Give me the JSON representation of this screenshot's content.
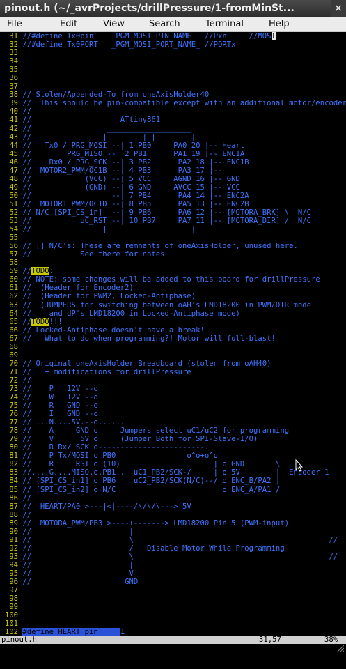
{
  "window": {
    "title": "pinout.h (~/_avrProjects/drillPressure/1-fromMinSt...",
    "close": "×"
  },
  "menu": [
    "File",
    "Edit",
    "View",
    "Search",
    "Terminal",
    "Help"
  ],
  "lines": [
    {
      "n": "31",
      "s": [
        {
          "t": "//#define Tx0pin    _PGM_MOSI_PIN_NAME_  //Pxn     //MOS"
        },
        {
          "t": "I",
          "c": "cursor"
        }
      ]
    },
    {
      "n": "32",
      "s": [
        {
          "t": "//#define Tx0PORT   _PGM_MOSI_PORT_NAME_ //PORTx"
        }
      ]
    },
    {
      "n": "33",
      "s": []
    },
    {
      "n": "34",
      "s": []
    },
    {
      "n": "35",
      "s": []
    },
    {
      "n": "36",
      "s": []
    },
    {
      "n": "37",
      "s": []
    },
    {
      "n": "38",
      "s": [
        {
          "t": "// Stolen/Appended-To from oneAxisHolder40"
        }
      ]
    },
    {
      "n": "39",
      "s": [
        {
          "t": "//  This should be pin-compatible except with an additional motor/encoder."
        }
      ]
    },
    {
      "n": "40",
      "s": [
        {
          "t": "//"
        }
      ]
    },
    {
      "n": "41",
      "s": [
        {
          "t": "//                    ATtiny861"
        }
      ]
    },
    {
      "n": "42",
      "s": [
        {
          "t": "//                 ___________________"
        }
      ]
    },
    {
      "n": "43",
      "s": [
        {
          "t": "//                |        |_|        |"
        }
      ]
    },
    {
      "n": "44",
      "s": [
        {
          "t": "//   Tx0 / PRG_MOSI --| 1 PB0     PA0 20 |-- Heart"
        }
      ]
    },
    {
      "n": "45",
      "s": [
        {
          "t": "//        PRG_MISO --| 2 PB1      PA1 19 |-- ENC1A"
        }
      ]
    },
    {
      "n": "46",
      "s": [
        {
          "t": "//    Rx0 / PRG_SCK --| 3 PB2      PA2 18 |-- ENC1B"
        }
      ]
    },
    {
      "n": "47",
      "s": [
        {
          "t": "//  MOTOR2_PWM/OC1B --| 4 PB3      PA3 17 |--"
        }
      ]
    },
    {
      "n": "48",
      "s": [
        {
          "t": "//            (VCC) --| 5 VCC     AGND 16 |-- GND"
        }
      ]
    },
    {
      "n": "49",
      "s": [
        {
          "t": "//            (GND) --| 6 GND     AVCC 15 |-- VCC"
        }
      ]
    },
    {
      "n": "50",
      "s": [
        {
          "t": "//                  --| 7 PB4      PA4 14 |-- ENC2A"
        }
      ]
    },
    {
      "n": "51",
      "s": [
        {
          "t": "//  MOTOR1_PWM/OC1D --| 8 PB5      PA5 13 |-- ENC2B"
        }
      ]
    },
    {
      "n": "52",
      "s": [
        {
          "t": "// N/C [SPI_CS_in]  --| 9 PB6      PA6 12 |-- [MOTORA_BRK] \\  N/C"
        }
      ]
    },
    {
      "n": "53",
      "s": [
        {
          "t": "//           uC_RST --| 10 PB7     PA7 11 |-- [MOTORA_DIR] /  N/C"
        }
      ]
    },
    {
      "n": "54",
      "s": [
        {
          "t": "//                |___________________|"
        }
      ]
    },
    {
      "n": "55",
      "s": []
    },
    {
      "n": "56",
      "s": [
        {
          "t": "// [] N/C's: These are remnants of oneAxisHolder, unused here."
        }
      ]
    },
    {
      "n": "57",
      "s": [
        {
          "t": "//           See there for notes"
        }
      ]
    },
    {
      "n": "58",
      "s": []
    },
    {
      "n": "59",
      "s": [
        {
          "t": "//"
        },
        {
          "t": "TODO",
          "c": "todo"
        },
        {
          "t": ":"
        }
      ]
    },
    {
      "n": "60",
      "s": [
        {
          "t": "// NOTE: some changes will be added to this board for drillPressure"
        }
      ]
    },
    {
      "n": "61",
      "s": [
        {
          "t": "//  (Header for Encoder2)"
        }
      ]
    },
    {
      "n": "62",
      "s": [
        {
          "t": "//  (Header for PWM2, Locked-Antiphase)"
        }
      ]
    },
    {
      "n": "63",
      "s": [
        {
          "t": "//  (JUMPERS for switching between oAH's LMD18200 in PWM/DIR mode"
        }
      ]
    },
    {
      "n": "64",
      "s": [
        {
          "t": "//    and dP's LMD18200 in Locked-Antiphase mode)"
        }
      ]
    },
    {
      "n": "65",
      "s": [
        {
          "t": "//"
        },
        {
          "t": "TODO",
          "c": "todo"
        },
        {
          "t": "!!!"
        }
      ]
    },
    {
      "n": "66",
      "s": [
        {
          "t": "// Locked-Antiphase doesn't have a break!"
        }
      ]
    },
    {
      "n": "67",
      "s": [
        {
          "t": "//   What to do when programming?! Motor will full-blast!"
        }
      ]
    },
    {
      "n": "68",
      "s": []
    },
    {
      "n": "69",
      "s": []
    },
    {
      "n": "70",
      "s": [
        {
          "t": "// Original oneAxisHolder Breadboard (stolen from oAH40)"
        }
      ]
    },
    {
      "n": "71",
      "s": [
        {
          "t": "//   + modifications for drillPressure"
        }
      ]
    },
    {
      "n": "72",
      "s": [
        {
          "t": "//"
        }
      ]
    },
    {
      "n": "73",
      "s": [
        {
          "t": "//    P   12V --o"
        }
      ]
    },
    {
      "n": "74",
      "s": [
        {
          "t": "//    W   12V --o"
        }
      ]
    },
    {
      "n": "75",
      "s": [
        {
          "t": "//    R   GND --o"
        }
      ]
    },
    {
      "n": "76",
      "s": [
        {
          "t": "//    I   GND --o"
        }
      ]
    },
    {
      "n": "77",
      "s": [
        {
          "t": "// ...N....5V.--o......"
        }
      ]
    },
    {
      "n": "78",
      "s": [
        {
          "t": "//    A     GND o     Jumpers select uC1/uC2 for programming"
        }
      ]
    },
    {
      "n": "79",
      "s": [
        {
          "t": "//    V      5V o     (Jumper Both for SPI-Slave-I/O)"
        }
      ]
    },
    {
      "n": "80",
      "s": [
        {
          "t": "//    R Rx/ SCK o------------------------."
        }
      ]
    },
    {
      "n": "81",
      "s": [
        {
          "t": "//    P Tx/MOSI o PB0                o^o+o^o"
        }
      ]
    },
    {
      "n": "82",
      "s": [
        {
          "t": "//    R     RST o (10)               |     | o GND       \\               //"
        }
      ]
    },
    {
      "n": "83",
      "s": [
        {
          "t": "//....G....MISO.o.PB1..  uC1_PB2/SCK-/     | o 5V        |  Encoder 1"
        }
      ]
    },
    {
      "n": "84",
      "s": [
        {
          "t": "// [SPI_CS_in1] o PB6    uC2_PB2/SCK(N/C)--/ o ENC_B/PA2 |"
        }
      ]
    },
    {
      "n": "85",
      "s": [
        {
          "t": "// [SPI_CS_in2] o N/C                        o ENC_A/PA1 /"
        }
      ]
    },
    {
      "n": "86",
      "s": [
        {
          "t": "//"
        }
      ]
    },
    {
      "n": "87",
      "s": [
        {
          "t": "//  HEART/PA0 >---|<|----/\\/\\/\\---> 5V"
        }
      ]
    },
    {
      "n": "88",
      "s": [
        {
          "t": "//"
        }
      ]
    },
    {
      "n": "89",
      "s": [
        {
          "t": "//  MOTORA_PWM/PB3 >----+-------> LMD18200 Pin 5 (PWM-input)"
        }
      ]
    },
    {
      "n": "90",
      "s": [
        {
          "t": "//                      |"
        }
      ]
    },
    {
      "n": "91",
      "s": [
        {
          "t": "//                      \\                                            //"
        }
      ]
    },
    {
      "n": "92",
      "s": [
        {
          "t": "//                      /   Disable Motor While Programming"
        }
      ]
    },
    {
      "n": "93",
      "s": [
        {
          "t": "//                      \\                                            //"
        }
      ]
    },
    {
      "n": "94",
      "s": [
        {
          "t": "//                      |"
        }
      ]
    },
    {
      "n": "95",
      "s": [
        {
          "t": "//                      V"
        }
      ]
    },
    {
      "n": "96",
      "s": [
        {
          "t": "//                     GND"
        }
      ]
    },
    {
      "n": "97",
      "s": []
    },
    {
      "n": "98",
      "s": []
    },
    {
      "n": "99",
      "s": []
    },
    {
      "n": "100",
      "s": []
    },
    {
      "n": "101",
      "s": []
    },
    {
      "n": "102",
      "s": [
        {
          "t": "#define HEART_pin     ",
          "c": "hl"
        },
        {
          "t": "1"
        }
      ]
    }
  ],
  "status": {
    "filename": "pinout.h",
    "position": "31,57",
    "percent": "38%"
  }
}
